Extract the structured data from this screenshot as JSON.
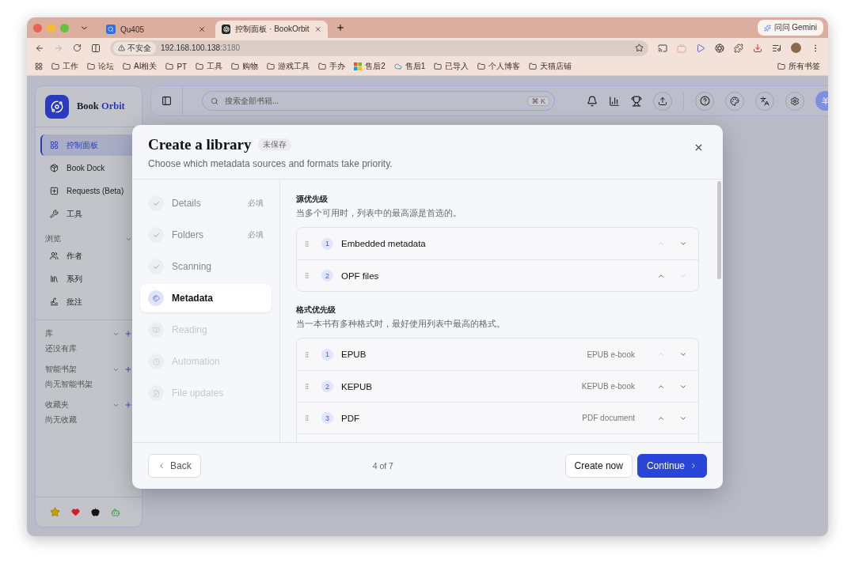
{
  "browser": {
    "tabs": [
      {
        "title": "Qu405",
        "selected": false,
        "kind": "site"
      },
      {
        "title": "控制面板 · BookOrbit",
        "selected": true,
        "kind": "app"
      }
    ],
    "address": {
      "security": "不安全",
      "host": "192.168.100.138",
      "port": ":3180"
    },
    "bookmarks": [
      {
        "label": "工作",
        "kind": "folder"
      },
      {
        "label": "论坛",
        "kind": "folder"
      },
      {
        "label": "AI相关",
        "kind": "folder"
      },
      {
        "label": "PT",
        "kind": "folder"
      },
      {
        "label": "工具",
        "kind": "folder"
      },
      {
        "label": "购物",
        "kind": "folder"
      },
      {
        "label": "游戏工具",
        "kind": "folder"
      },
      {
        "label": "手办",
        "kind": "folder"
      },
      {
        "label": "售后2",
        "kind": "tiles"
      },
      {
        "label": "售后1",
        "kind": "site"
      },
      {
        "label": "已导入",
        "kind": "folder"
      },
      {
        "label": "个人博客",
        "kind": "folder"
      },
      {
        "label": "天猫店铺",
        "kind": "folder"
      }
    ],
    "all_bookmarks": "所有书签",
    "gemini": "问问 Gemini"
  },
  "sidebar": {
    "brand": {
      "first": "Book",
      "second": "Orbit"
    },
    "nav": [
      {
        "label": "控制面板",
        "selected": true
      },
      {
        "label": "Book Dock",
        "selected": false
      },
      {
        "label": "Requests (Beta)",
        "selected": false
      },
      {
        "label": "工具",
        "selected": false
      }
    ],
    "browse": {
      "title": "浏览",
      "items": [
        {
          "label": "作者"
        },
        {
          "label": "系列"
        },
        {
          "label": "批注"
        }
      ]
    },
    "collections": [
      {
        "title": "库",
        "empty": "还没有库"
      },
      {
        "title": "智能书架",
        "empty": "尚无智能书架"
      },
      {
        "title": "收藏夹",
        "empty": "尚无收藏"
      }
    ]
  },
  "topbar": {
    "search": {
      "placeholder": "搜索全部书籍...",
      "shortcut": "⌘ K"
    },
    "avatar": "羊"
  },
  "modal": {
    "title": "Create a library",
    "badge": "未保存",
    "subtitle": "Choose which metadata sources and formats take priority.",
    "steps": [
      {
        "label": "Details",
        "completed": true,
        "selected": false,
        "tag": "必填"
      },
      {
        "label": "Folders",
        "completed": true,
        "selected": false,
        "tag": "必填"
      },
      {
        "label": "Scanning",
        "completed": true,
        "selected": false
      },
      {
        "label": "Metadata",
        "completed": false,
        "selected": true
      },
      {
        "label": "Reading",
        "completed": false,
        "selected": false
      },
      {
        "label": "Automation",
        "completed": false,
        "selected": false
      },
      {
        "label": "File updates",
        "completed": false,
        "selected": false
      }
    ],
    "sections": [
      {
        "title": "源优先级",
        "description": "当多个可用时，列表中的最高源是首选的。",
        "items": [
          {
            "rank": "1",
            "name": "Embedded metadata",
            "up_enabled": false,
            "down_enabled": true
          },
          {
            "rank": "2",
            "name": "OPF files",
            "up_enabled": true,
            "down_enabled": false
          }
        ]
      },
      {
        "title": "格式优先级",
        "description": "当一本书有多种格式时，最好使用列表中最高的格式。",
        "items": [
          {
            "rank": "1",
            "name": "EPUB",
            "detail": "EPUB e-book",
            "up_enabled": false,
            "down_enabled": true
          },
          {
            "rank": "2",
            "name": "KEPUB",
            "detail": "KEPUB e-book",
            "up_enabled": true,
            "down_enabled": true
          },
          {
            "rank": "3",
            "name": "PDF",
            "detail": "PDF document",
            "up_enabled": true,
            "down_enabled": true
          }
        ]
      }
    ],
    "footer": {
      "back": "Back",
      "step_count": "4 of 7",
      "create": "Create now",
      "continue": "Continue"
    }
  }
}
